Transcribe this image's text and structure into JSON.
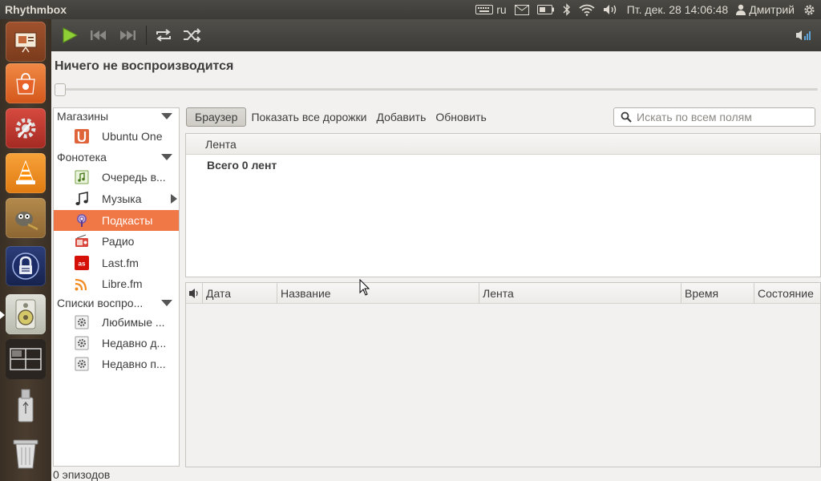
{
  "panel": {
    "app_title": "Rhythmbox",
    "keyboard_layout": "ru",
    "clock": "Пт. дек. 28 14:06:48",
    "user": "Дмитрий"
  },
  "launcher": {
    "items": [
      "presentation-app",
      "ubuntu-software-center",
      "system-settings",
      "vlc",
      "gimp",
      "keepassx",
      "rhythmbox",
      "workspace-switcher",
      "usb-drive",
      "trash"
    ]
  },
  "player": {
    "now_playing": "Ничего не воспроизводится"
  },
  "sidebar": {
    "groups": [
      {
        "label": "Магазины"
      },
      {
        "label": "Фонотека"
      },
      {
        "label": "Списки воспро..."
      }
    ],
    "items": [
      {
        "label": "Ubuntu One",
        "icon": "ubuntu-one-icon"
      },
      {
        "label": "Очередь в...",
        "icon": "play-queue-icon"
      },
      {
        "label": "Музыка",
        "icon": "music-icon"
      },
      {
        "label": "Подкасты",
        "icon": "podcast-icon"
      },
      {
        "label": "Радио",
        "icon": "radio-icon"
      },
      {
        "label": "Last.fm",
        "icon": "lastfm-icon"
      },
      {
        "label": "Libre.fm",
        "icon": "librefm-icon"
      },
      {
        "label": "Любимые ...",
        "icon": "playlist-icon"
      },
      {
        "label": "Недавно д...",
        "icon": "playlist-icon"
      },
      {
        "label": "Недавно п...",
        "icon": "playlist-icon"
      }
    ]
  },
  "browse": {
    "browser_label": "Браузер",
    "show_all_label": "Показать все дорожки",
    "add_label": "Добавить",
    "refresh_label": "Обновить",
    "search_placeholder": "Искать по всем полям"
  },
  "feeds": {
    "column": "Лента",
    "total": "Всего 0 лент"
  },
  "episodes": {
    "columns": [
      "Дата",
      "Название",
      "Лента",
      "Время",
      "Состояние"
    ]
  },
  "status": {
    "text": "0 эпизодов"
  },
  "colors": {
    "accent": "#f07746",
    "panel": "#3c3b37"
  }
}
